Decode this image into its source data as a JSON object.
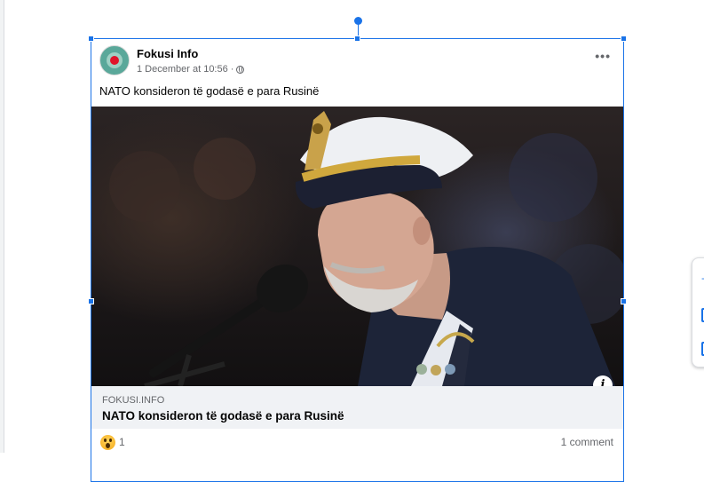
{
  "post": {
    "page_name": "Fokusi Info",
    "timestamp": "1 December at 10:56",
    "separator": "·",
    "more_label": "•••",
    "text": "NATO konsideron të godasë e para Rusinë",
    "link_preview": {
      "domain": "FOKUSI.INFO",
      "title": "NATO konsideron të godasë e para Rusinë"
    },
    "info_label": "i",
    "reaction_count": "1",
    "comment_count": "1 comment"
  },
  "colors": {
    "selection": "#1a73e8",
    "link_preview_bg": "#f0f2f5",
    "secondary_text": "#65676b"
  },
  "icons": {
    "privacy": "globe-icon",
    "reaction": "wow-reaction-icon",
    "menu": "more-horizontal-icon",
    "info": "info-icon"
  }
}
